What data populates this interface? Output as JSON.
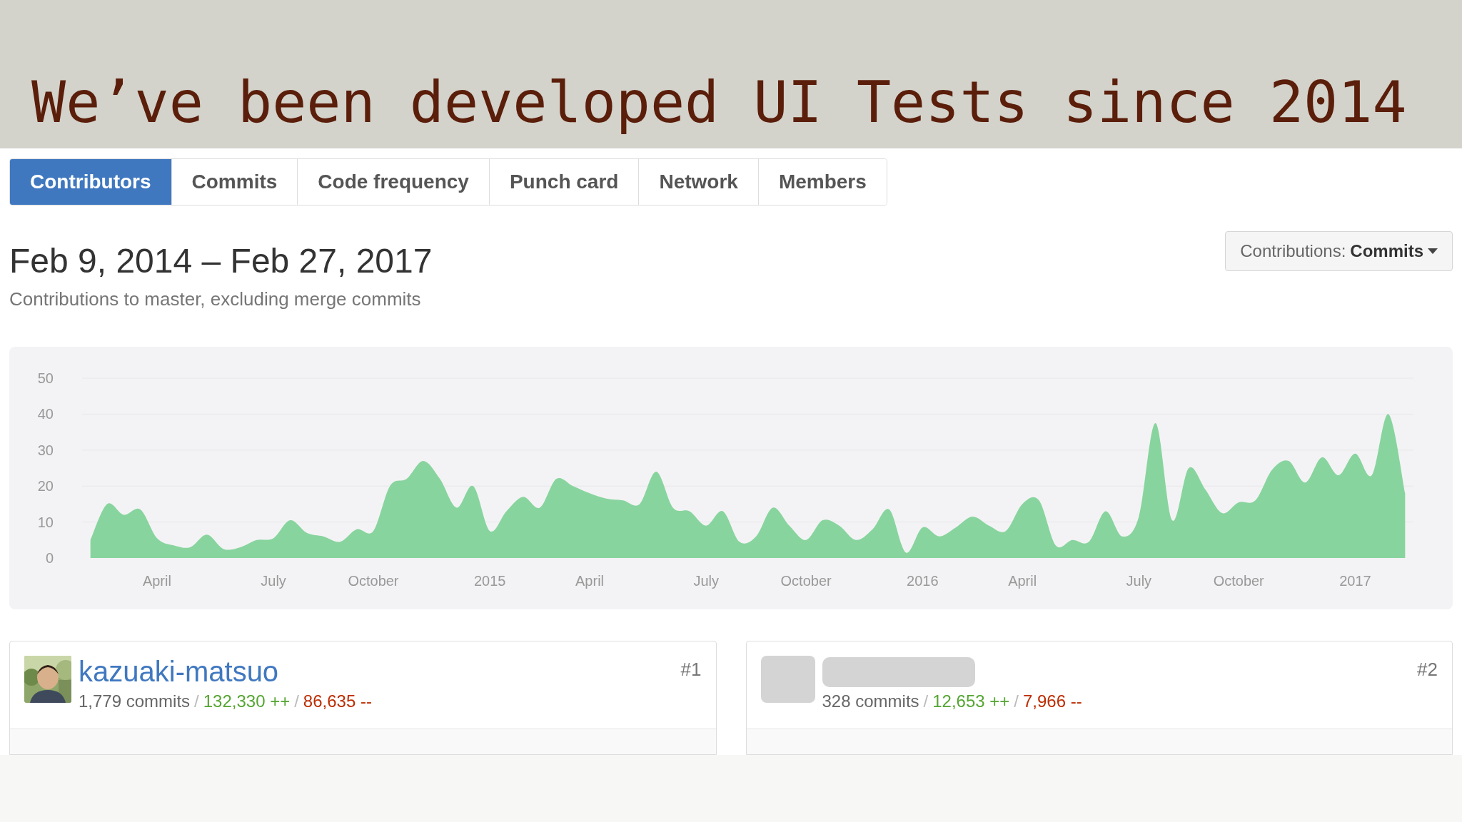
{
  "slide_title": "We’ve been developed UI Tests since 2014",
  "tabs": [
    {
      "label": "Contributors",
      "selected": true
    },
    {
      "label": "Commits",
      "selected": false
    },
    {
      "label": "Code frequency",
      "selected": false
    },
    {
      "label": "Punch card",
      "selected": false
    },
    {
      "label": "Network",
      "selected": false
    },
    {
      "label": "Members",
      "selected": false
    }
  ],
  "heading": "Feb 9, 2014 – Feb 27, 2017",
  "subheading": "Contributions to master, excluding merge commits",
  "contributions_dropdown": {
    "label": "Contributions:",
    "value": "Commits"
  },
  "chart_data": {
    "type": "area",
    "categories": [
      null,
      null,
      null,
      null,
      "April",
      null,
      null,
      null,
      null,
      null,
      null,
      "July",
      null,
      null,
      null,
      null,
      null,
      "October",
      null,
      null,
      null,
      null,
      null,
      null,
      "2015",
      null,
      null,
      null,
      null,
      null,
      "April",
      null,
      null,
      null,
      null,
      null,
      null,
      "July",
      null,
      null,
      null,
      null,
      null,
      "October",
      null,
      null,
      null,
      null,
      null,
      null,
      "2016",
      null,
      null,
      null,
      null,
      null,
      "April",
      null,
      null,
      null,
      null,
      null,
      null,
      "July",
      null,
      null,
      null,
      null,
      null,
      "October",
      null,
      null,
      null,
      null,
      null,
      null,
      "2017",
      null,
      null,
      null
    ],
    "series": [
      {
        "color": "#88d49e",
        "values": [
          5,
          15,
          12,
          13.5,
          5.5,
          3.5,
          3,
          6.5,
          2.5,
          3,
          5,
          5.5,
          10.5,
          7,
          6,
          4.5,
          8,
          7.5,
          20,
          22,
          27,
          22,
          14,
          20,
          7.5,
          13,
          17,
          14,
          22,
          20,
          18,
          16.5,
          16,
          15,
          24,
          14,
          13,
          9,
          13,
          4.5,
          6,
          14,
          9,
          5,
          10.5,
          9,
          5,
          8,
          13.5,
          1.5,
          8.5,
          6,
          8.5,
          11.5,
          9,
          7.5,
          15,
          16,
          3.5,
          5,
          4.5,
          13,
          6,
          11.5,
          37.5,
          10.5,
          25,
          19,
          12.5,
          15.5,
          16,
          24.5,
          27,
          21,
          28,
          23,
          29,
          23,
          40,
          18
        ]
      }
    ],
    "ylim": [
      0,
      50
    ],
    "yticks": [
      0,
      10,
      20,
      30,
      40,
      50
    ],
    "grid": true
  },
  "contributors": [
    {
      "avatar": {
        "kind": "picture"
      },
      "name": "kazuaki-matsuo",
      "rank": "#1",
      "stats": [
        {
          "kind": "commits",
          "text": "1,779 commits"
        },
        {
          "kind": "separator",
          "text": "/"
        },
        {
          "kind": "additions",
          "text": "132,330 ++"
        },
        {
          "kind": "separator",
          "text": "/"
        },
        {
          "kind": "deletions",
          "text": "86,635 --"
        }
      ]
    },
    {
      "avatar": {
        "kind": "blurred"
      },
      "rank": "#2",
      "stats": [
        {
          "kind": "commits",
          "text": "328 commits"
        },
        {
          "kind": "separator",
          "text": "/"
        },
        {
          "kind": "additions",
          "text": "12,653 ++"
        },
        {
          "kind": "separator",
          "text": "/"
        },
        {
          "kind": "deletions",
          "text": "7,966 --"
        }
      ]
    }
  ]
}
